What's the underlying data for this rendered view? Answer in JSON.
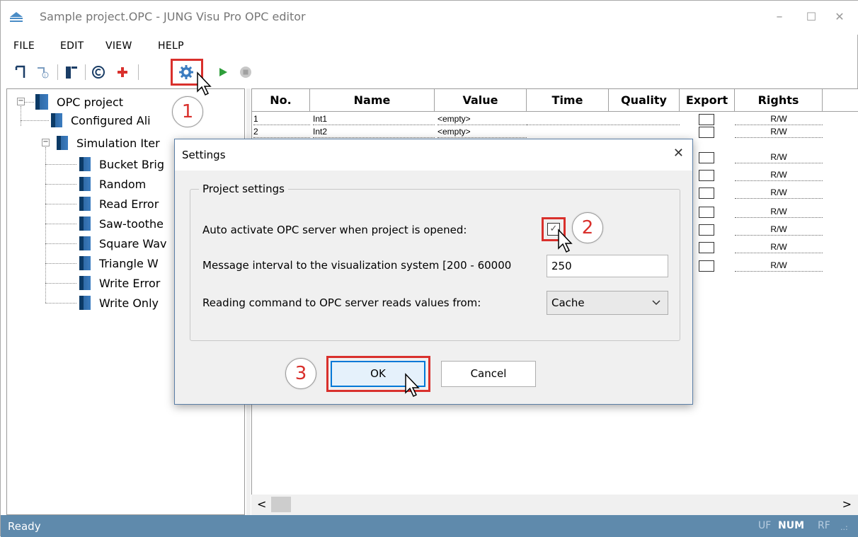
{
  "window": {
    "title": "Sample project.OPC - JUNG Visu Pro OPC editor",
    "controls": {
      "minimize": "–",
      "maximize": "☐",
      "close": "✕"
    }
  },
  "menubar": {
    "items": [
      "FILE",
      "EDIT",
      "VIEW",
      "HELP"
    ]
  },
  "toolbar": {
    "icons": [
      "new-item-icon",
      "new-info-icon",
      "import-icon",
      "copyright-icon",
      "add-icon",
      "settings-icon",
      "play-icon",
      "stop-icon"
    ],
    "accent": "#d9302c"
  },
  "tree": {
    "root": "OPC project",
    "items": [
      {
        "label": "Configured Ali"
      },
      {
        "label": "Simulation Iter"
      },
      {
        "label": "Bucket Brig"
      },
      {
        "label": "Random"
      },
      {
        "label": "Read Error"
      },
      {
        "label": "Saw-toothe"
      },
      {
        "label": "Square Wav"
      },
      {
        "label": "Triangle W"
      },
      {
        "label": "Write Error"
      },
      {
        "label": "Write Only"
      }
    ]
  },
  "grid": {
    "columns": [
      "No.",
      "Name",
      "Value",
      "Time",
      "Quality",
      "Export",
      "Rights"
    ],
    "rows": [
      {
        "no": "1",
        "name": "Int1",
        "value": "<empty>",
        "rights": "R/W"
      },
      {
        "no": "2",
        "name": "Int2",
        "value": "<empty>",
        "rights": "R/W"
      },
      {
        "no": "",
        "name": "",
        "value": "",
        "rights": "R/W"
      },
      {
        "no": "",
        "name": "",
        "value": "",
        "rights": "R/W"
      },
      {
        "no": "",
        "name": "",
        "value": "",
        "rights": "R/W"
      },
      {
        "no": "",
        "name": "",
        "value": "",
        "rights": "R/W"
      },
      {
        "no": "",
        "name": "",
        "value": "",
        "rights": "R/W"
      },
      {
        "no": "",
        "name": "",
        "value": "",
        "rights": "R/W"
      },
      {
        "no": "",
        "name": "",
        "value": "",
        "rights": "R/W"
      }
    ]
  },
  "dialog": {
    "title": "Settings",
    "close": "✕",
    "group_label": "Project settings",
    "auto_activate_label": "Auto activate OPC server when project is opened:",
    "auto_activate_checked": "✓",
    "interval_label": "Message interval to the visualization system [200 - 60000",
    "interval_value": "250",
    "reading_label": "Reading command to OPC server reads values from:",
    "reading_value": "Cache",
    "ok_label": "OK",
    "cancel_label": "Cancel"
  },
  "callouts": {
    "step1": "1",
    "step2": "2",
    "step3": "3"
  },
  "statusbar": {
    "text": "Ready",
    "indicators": {
      "uf": "UF",
      "num": "NUM",
      "rf": "RF"
    },
    "grip": "..:"
  },
  "hscroll": {
    "left": "<",
    "right": ">"
  }
}
